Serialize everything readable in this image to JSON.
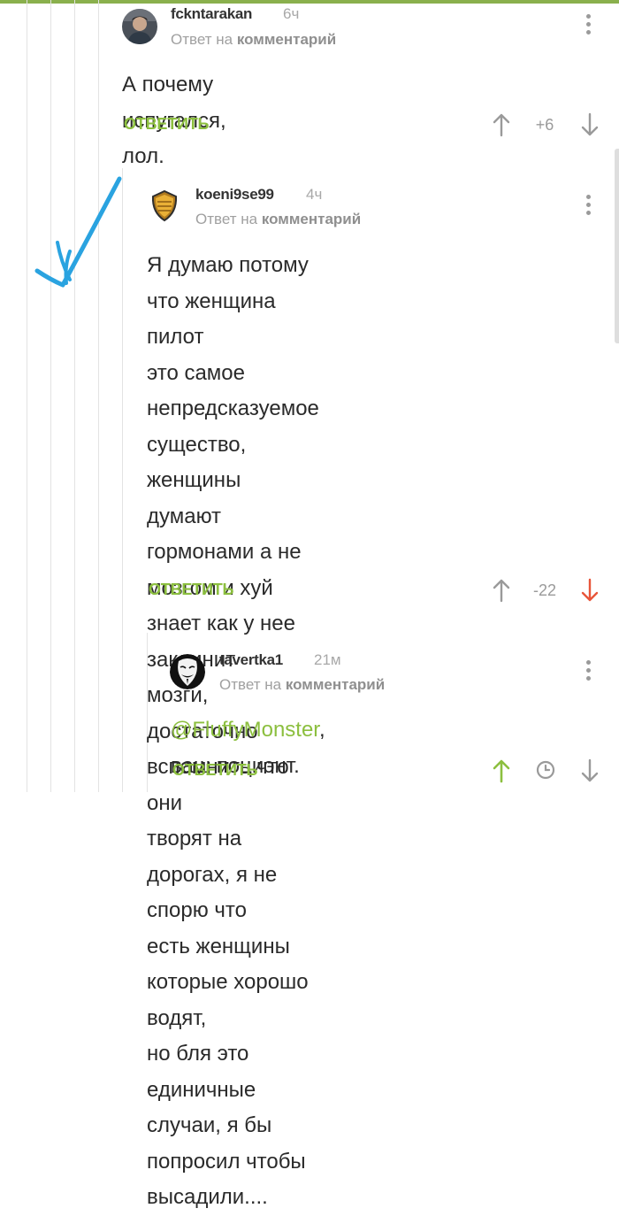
{
  "comments": [
    {
      "username": "fckntarakan",
      "time": "6ч",
      "reply_prefix": "Ответ на",
      "reply_target": "комментарий",
      "text": "А почему испугался, лол.",
      "reply_label": "ОТВЕТИТЬ",
      "score": "+6",
      "voted": "none"
    },
    {
      "username": "koeni9se99",
      "time": "4ч",
      "reply_prefix": "Ответ на",
      "reply_target": "комментарий",
      "text_lines": [
        "Я думаю потому что женщина пилот",
        "это самое непредсказуемое существо,",
        "женщины думают гормонами а не",
        "мозгом и хуй знает как у нее заклинит",
        "мозги, достаточно вспомнить что они",
        "творят на дорогах, я не спорю что",
        "есть женщины которые хорошо водят,",
        "но бля это единичные случаи, я бы",
        "попросил чтобы высадили...."
      ],
      "reply_label": "ОТВЕТИТЬ",
      "score": "-22",
      "voted": "down"
    },
    {
      "username": "tavertka1",
      "time": "21м",
      "reply_prefix": "Ответ на",
      "reply_target": "комментарий",
      "mention": "@FluffyMonster",
      "text": ",  ваш поциэнт.",
      "reply_label": "ОТВЕТИТЬ",
      "score_icon": "clock-icon",
      "voted": "up"
    }
  ],
  "colors": {
    "accent_green": "#8cbf3f",
    "downvote_red": "#e8553a",
    "icon_gray": "#9a9a9a",
    "annotation_blue": "#2aa3e0"
  }
}
